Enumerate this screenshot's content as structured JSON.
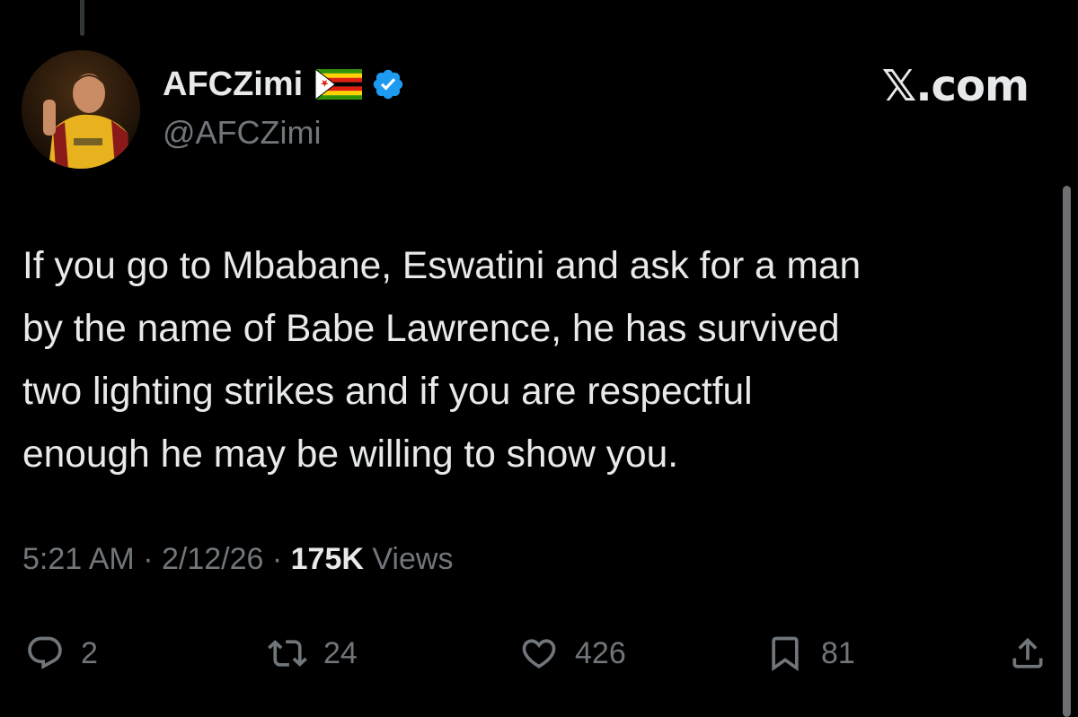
{
  "user": {
    "display_name": "AFCZimi",
    "handle": "@AFCZimi",
    "flag_icon": "zimbabwe-flag-icon",
    "verified_icon": "verified-badge-icon",
    "verified_color": "#1d9bf0"
  },
  "brand": {
    "label": "𝕏.com"
  },
  "tweet": {
    "text": "If you go to Mbabane, Eswatini and ask for a man\nby the name of Babe Lawrence, he has survived\ntwo lighting strikes and if you are respectful\nenough he may be willing to show you."
  },
  "meta": {
    "time": "5:21 AM",
    "date": "2/12/26",
    "separator": " · ",
    "views_count": "175K",
    "views_label": " Views"
  },
  "actions": {
    "reply": {
      "icon": "reply-icon",
      "count": "2"
    },
    "retweet": {
      "icon": "retweet-icon",
      "count": "24"
    },
    "like": {
      "icon": "heart-icon",
      "count": "426"
    },
    "bookmark": {
      "icon": "bookmark-icon",
      "count": "81"
    },
    "share": {
      "icon": "share-icon"
    }
  },
  "colors": {
    "background": "#000000",
    "text_primary": "#e7e9ea",
    "text_secondary": "#71767b",
    "accent": "#1d9bf0"
  }
}
